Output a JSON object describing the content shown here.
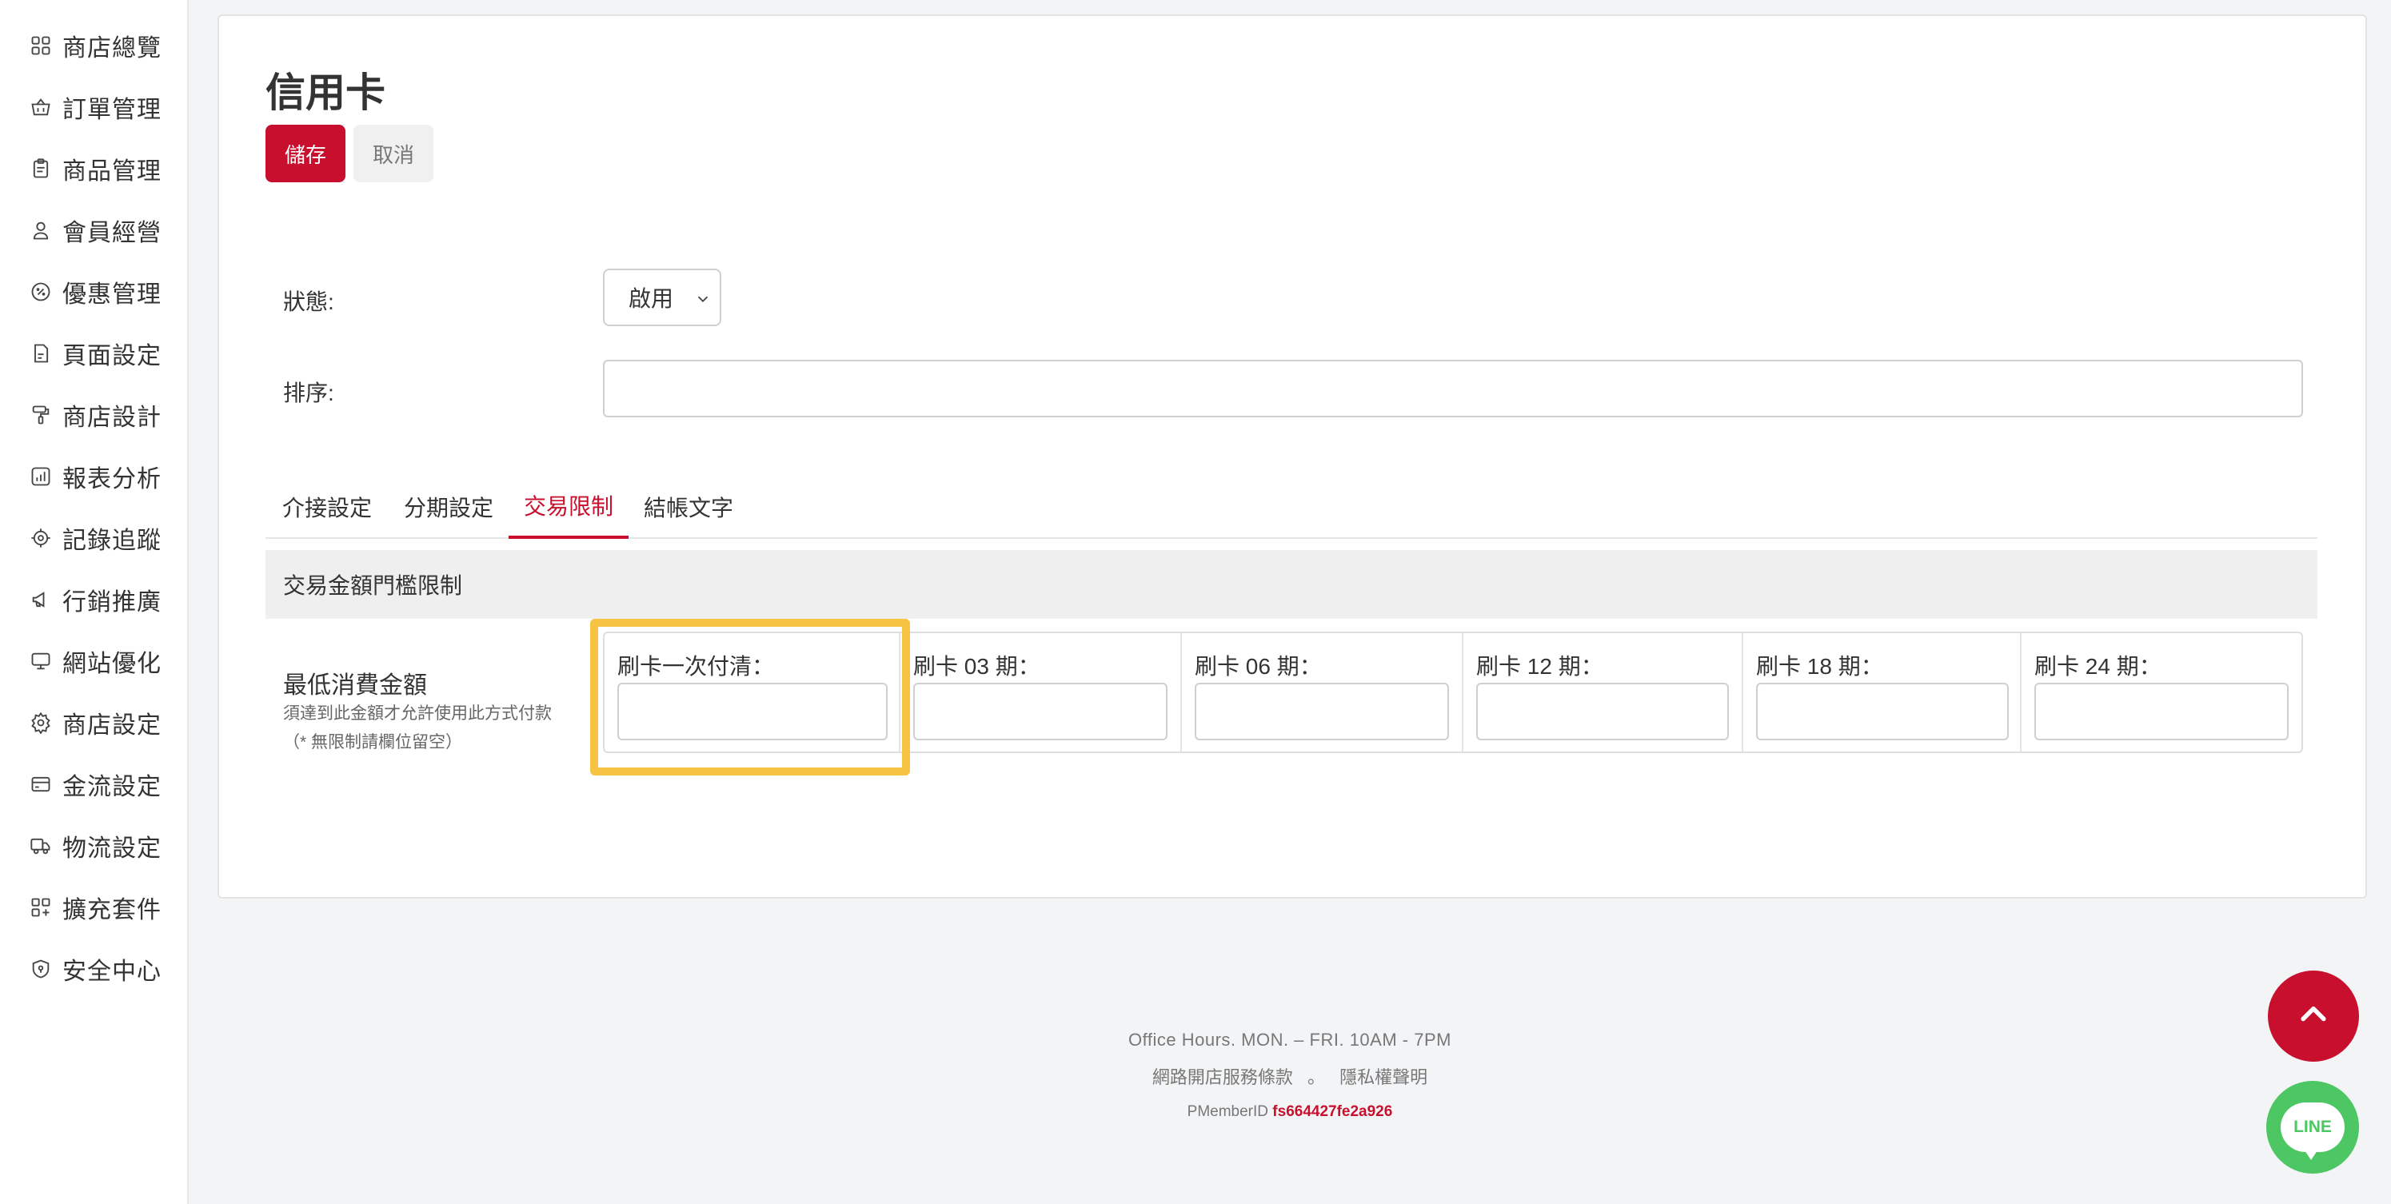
{
  "sidebar": {
    "items": [
      {
        "label": "商店總覽",
        "icon": "grid-icon"
      },
      {
        "label": "訂單管理",
        "icon": "basket-icon"
      },
      {
        "label": "商品管理",
        "icon": "clipboard-icon"
      },
      {
        "label": "會員經營",
        "icon": "user-icon"
      },
      {
        "label": "優惠管理",
        "icon": "discount-badge-icon"
      },
      {
        "label": "頁面設定",
        "icon": "page-icon"
      },
      {
        "label": "商店設計",
        "icon": "paint-roller-icon"
      },
      {
        "label": "報表分析",
        "icon": "chart-icon"
      },
      {
        "label": "記錄追蹤",
        "icon": "target-icon"
      },
      {
        "label": "行銷推廣",
        "icon": "megaphone-icon"
      },
      {
        "label": "網站優化",
        "icon": "monitor-icon"
      },
      {
        "label": "商店設定",
        "icon": "gear-icon"
      },
      {
        "label": "金流設定",
        "icon": "credit-card-icon"
      },
      {
        "label": "物流設定",
        "icon": "truck-icon"
      },
      {
        "label": "擴充套件",
        "icon": "apps-plus-icon"
      },
      {
        "label": "安全中心",
        "icon": "shield-icon"
      }
    ]
  },
  "page": {
    "title": "信用卡",
    "save_label": "儲存",
    "cancel_label": "取消"
  },
  "form": {
    "status_label": "狀態:",
    "status_value": "啟用",
    "sort_label": "排序:",
    "sort_value": ""
  },
  "tabs": [
    {
      "label": "介接設定",
      "active": false
    },
    {
      "label": "分期設定",
      "active": false
    },
    {
      "label": "交易限制",
      "active": true
    },
    {
      "label": "結帳文字",
      "active": false
    }
  ],
  "section": {
    "title": "交易金額門檻限制",
    "min_label": "最低消費金額",
    "min_note_1": "須達到此金額才允許使用此方式付款",
    "min_note_2": "（* 無限制請欄位留空）"
  },
  "installments": [
    {
      "label": "刷卡一次付清：",
      "value": ""
    },
    {
      "label": "刷卡 03 期：",
      "value": ""
    },
    {
      "label": "刷卡 06 期：",
      "value": ""
    },
    {
      "label": "刷卡 12 期：",
      "value": ""
    },
    {
      "label": "刷卡 18 期：",
      "value": ""
    },
    {
      "label": "刷卡 24 期：",
      "value": ""
    }
  ],
  "footer": {
    "hours": "Office Hours.  MON. – FRI.  10AM - 7PM",
    "terms": "網路開店服務條款",
    "separator": "。",
    "privacy": "隱私權聲明",
    "member_id_label": "PMemberID",
    "member_id": "fs664427fe2a926"
  },
  "floating": {
    "line_label": "LINE"
  },
  "colors": {
    "accent": "#c8102e",
    "highlight": "#f6c343",
    "line_green": "#4cc764"
  }
}
